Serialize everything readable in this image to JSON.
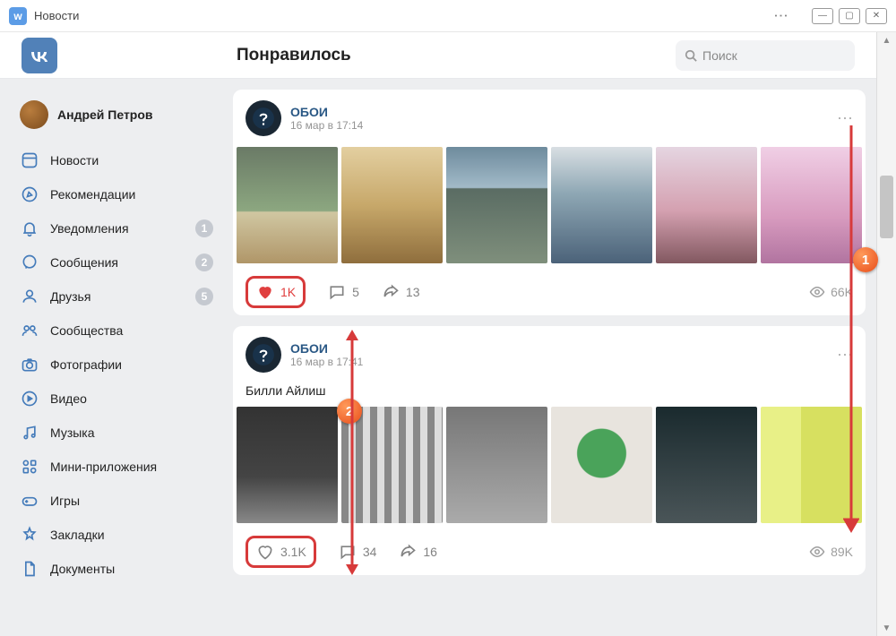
{
  "window": {
    "title": "Новости"
  },
  "header": {
    "page_title": "Понравилось",
    "search_placeholder": "Поиск"
  },
  "user": {
    "name": "Андрей Петров"
  },
  "sidebar": {
    "items": [
      {
        "label": "Новости",
        "icon": "news"
      },
      {
        "label": "Рекомендации",
        "icon": "compass"
      },
      {
        "label": "Уведомления",
        "icon": "bell",
        "badge": "1"
      },
      {
        "label": "Сообщения",
        "icon": "message",
        "badge": "2"
      },
      {
        "label": "Друзья",
        "icon": "friends",
        "badge": "5"
      },
      {
        "label": "Сообщества",
        "icon": "communities"
      },
      {
        "label": "Фотографии",
        "icon": "camera"
      },
      {
        "label": "Видео",
        "icon": "video"
      },
      {
        "label": "Музыка",
        "icon": "music"
      },
      {
        "label": "Мини-приложения",
        "icon": "apps"
      },
      {
        "label": "Игры",
        "icon": "games"
      },
      {
        "label": "Закладки",
        "icon": "bookmark"
      },
      {
        "label": "Документы",
        "icon": "document"
      }
    ]
  },
  "posts": [
    {
      "author": "ОБОИ",
      "time": "16 мар в 17:14",
      "liked": true,
      "likes": "1K",
      "comments": "5",
      "shares": "13",
      "views": "66K"
    },
    {
      "author": "ОБОИ",
      "time": "16 мар в 17:41",
      "text": "Билли Айлиш",
      "liked": false,
      "likes": "3.1K",
      "comments": "34",
      "shares": "16",
      "views": "89K"
    }
  ],
  "annotations": {
    "marker1": "1",
    "marker2": "2"
  }
}
